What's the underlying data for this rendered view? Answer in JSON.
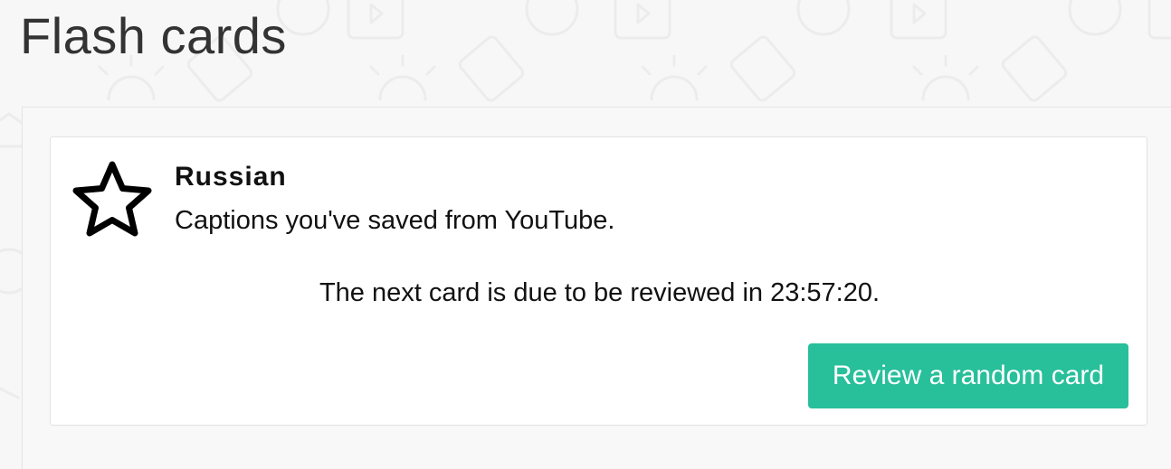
{
  "page": {
    "title": "Flash cards"
  },
  "deck": {
    "name": "Russian",
    "description": "Captions you've saved from YouTube.",
    "icon": "star-icon",
    "due_message": "The next card is due to be reviewed in 23:57:20."
  },
  "actions": {
    "review_label": "Review a random card"
  },
  "colors": {
    "accent": "#28bf9b",
    "title_text": "#333333",
    "background": "#f7f7f7"
  }
}
